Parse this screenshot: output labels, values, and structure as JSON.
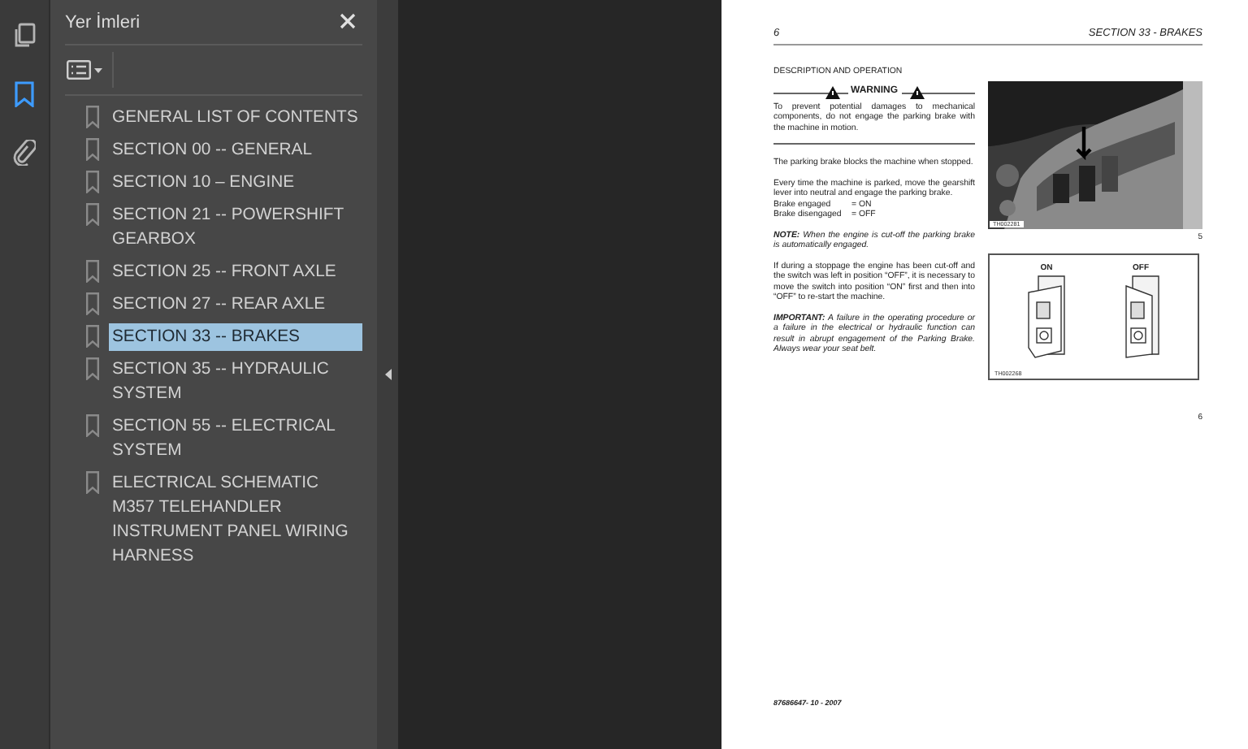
{
  "rail": {
    "items": [
      {
        "kind": "pages",
        "selected": false
      },
      {
        "kind": "bookmarks",
        "selected": true
      },
      {
        "kind": "attachments",
        "selected": false
      }
    ]
  },
  "panel": {
    "title": "Yer İmleri",
    "bookmarks": [
      {
        "label": "GENERAL LIST OF CONTENTS",
        "selected": false
      },
      {
        "label": "SECTION 00 -- GENERAL",
        "selected": false
      },
      {
        "label": "SECTION 10 – ENGINE",
        "selected": false
      },
      {
        "label": "SECTION 21 -- POWERSHIFT GEARBOX",
        "selected": false
      },
      {
        "label": "SECTION 25 -- FRONT AXLE",
        "selected": false
      },
      {
        "label": "SECTION 27 -- REAR AXLE",
        "selected": false
      },
      {
        "label": "SECTION 33 -- BRAKES",
        "selected": true
      },
      {
        "label": "SECTION 35 -- HYDRAULIC SYSTEM",
        "selected": false
      },
      {
        "label": "SECTION 55 -- ELECTRICAL SYSTEM",
        "selected": false
      },
      {
        "label": "ELECTRICAL SCHEMATIC M357 TELEHANDLER INSTRUMENT PANEL WIRING HARNESS",
        "selected": false
      }
    ]
  },
  "page": {
    "number": "6",
    "header": "SECTION 33 - BRAKES",
    "heading": "DESCRIPTION AND OPERATION",
    "warning": {
      "title": "WARNING",
      "text": "To prevent potential damages to mechanical components, do not engage the parking brake with the machine in motion."
    },
    "paragraphs": [
      {
        "kind": "plain",
        "text": "The parking brake blocks the machine when stopped."
      },
      {
        "kind": "plain",
        "text": "Every time the machine is parked, move the gearshift lever into neutral and engage the parking brake."
      },
      {
        "kind": "settings",
        "rows": [
          {
            "label": "Brake engaged",
            "value": "= ON"
          },
          {
            "label": "Brake disengaged",
            "value": "= OFF"
          }
        ]
      },
      {
        "kind": "note",
        "text": "**NOTE:** When the engine is cut-off the parking brake is automatically engaged."
      },
      {
        "kind": "plain",
        "text": "If during a stoppage the engine has been cut-off and the switch was left in position “OFF”, it is necessary to move the switch into position “ON” first and then into “OFF” to re-start the machine."
      },
      {
        "kind": "note",
        "text": "**IMPORTANT:** A failure in the operating procedure or a failure in the electrical or hydraulic function can result in abrupt engagement of the Parking Brake. Always wear your seat belt."
      }
    ],
    "figures": [
      {
        "code": "TH002281",
        "number": "5"
      },
      {
        "kind": "switches",
        "labels": [
          "ON",
          "OFF"
        ],
        "code": "TH002268",
        "number": "6"
      }
    ],
    "footer": "87686647- 10 - 2007"
  }
}
